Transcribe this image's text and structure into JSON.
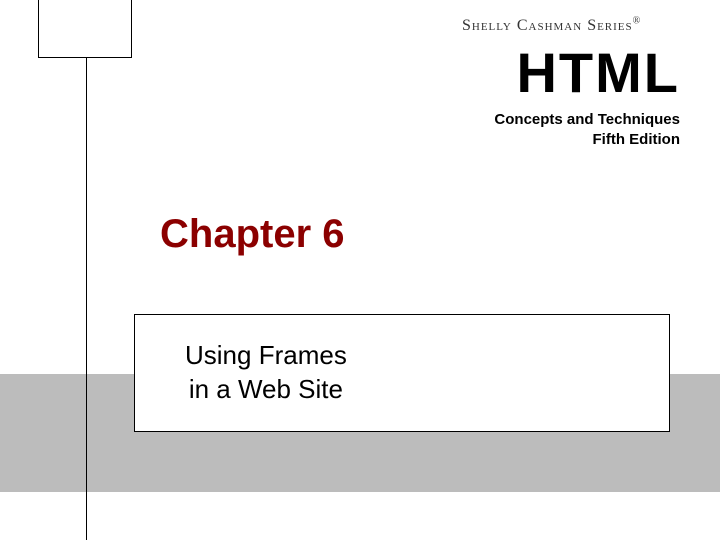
{
  "series": {
    "publisher": "Shelly Cashman Series",
    "registered": "®"
  },
  "book": {
    "title": "HTML",
    "subtitle_line1": "Concepts and Techniques",
    "subtitle_line2": "Fifth Edition"
  },
  "chapter": {
    "label": "Chapter 6",
    "topic_line1": "Using Frames",
    "topic_line2": "in a Web Site"
  }
}
